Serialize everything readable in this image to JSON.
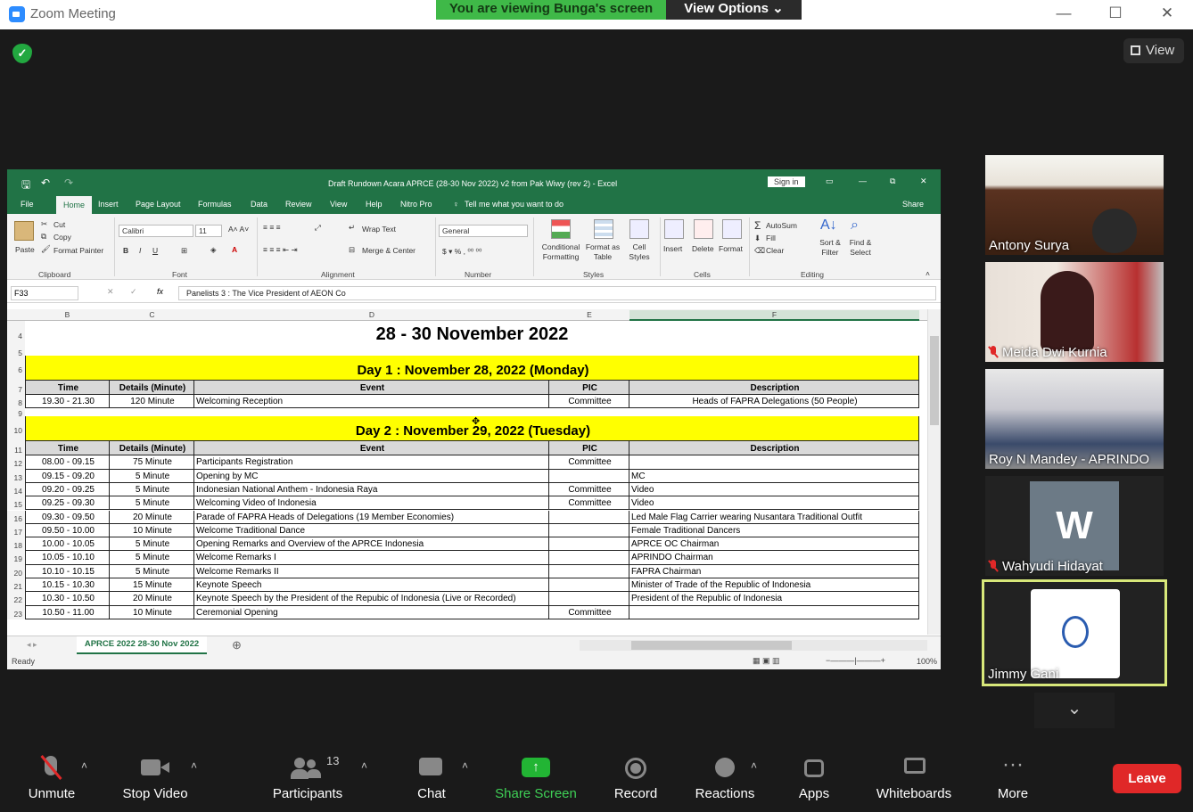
{
  "zoom": {
    "window_title": "Zoom Meeting",
    "share_banner": "You are viewing Bunga's screen",
    "view_options": "View Options ⌄",
    "view_button": "View",
    "leave": "Leave"
  },
  "excel": {
    "title": "Draft Rundown Acara APRCE (28-30 Nov 2022) v2 from Pak Wiwy (rev 2)  -  Excel",
    "sign_in": "Sign in",
    "tabs": [
      "File",
      "Home",
      "Insert",
      "Page Layout",
      "Formulas",
      "Data",
      "Review",
      "View",
      "Help",
      "Nitro Pro"
    ],
    "tell_me": "Tell me what you want to do",
    "share": "Share",
    "ribbon": {
      "paste": "Paste",
      "cut": "Cut",
      "copy": "Copy",
      "format_painter": "Format Painter",
      "clipboard": "Clipboard",
      "font_name": "Calibri",
      "font_size": "11",
      "font": "Font",
      "wrap_text": "Wrap Text",
      "merge_center": "Merge & Center",
      "alignment": "Alignment",
      "number_format": "General",
      "number": "Number",
      "conditional_formatting": "Conditional Formatting",
      "format_as_table": "Format as Table",
      "cell_styles": "Cell Styles",
      "styles": "Styles",
      "insert": "Insert",
      "delete": "Delete",
      "format": "Format",
      "cells": "Cells",
      "autosum": "AutoSum",
      "fill": "Fill",
      "clear": "Clear",
      "sort_filter": "Sort & Filter",
      "find_select": "Find & Select",
      "editing": "Editing"
    },
    "name_box": "F33",
    "formula": "Panelists 3 : The Vice President of AEON Co",
    "columns": [
      "B",
      "C",
      "D",
      "E",
      "F"
    ],
    "sheet_tab": "APRCE 2022 28-30 Nov 2022",
    "status": "Ready",
    "zoom": "100%",
    "rows": [
      {
        "n": "4",
        "type": "title",
        "text": "28 - 30 November 2022"
      },
      {
        "n": "5",
        "type": "blank"
      },
      {
        "n": "6",
        "type": "day",
        "text": "Day 1 : November 28, 2022 (Monday)"
      },
      {
        "n": "7",
        "type": "header",
        "cells": [
          "Time",
          "Details (Minute)",
          "Event",
          "PIC",
          "Description"
        ]
      },
      {
        "n": "8",
        "type": "data",
        "cells": [
          "19.30 - 21.30",
          "120 Minute",
          "Welcoming Reception",
          "Committee",
          "Heads of FAPRA Delegations (50 People)"
        ],
        "desc_center": true
      },
      {
        "n": "9",
        "type": "blank"
      },
      {
        "n": "10",
        "type": "day",
        "text": "Day 2 : November 29, 2022 (Tuesday)"
      },
      {
        "n": "11",
        "type": "header",
        "cells": [
          "Time",
          "Details (Minute)",
          "Event",
          "PIC",
          "Description"
        ]
      },
      {
        "n": "12",
        "type": "data",
        "cells": [
          "08.00 - 09.15",
          "75 Minute",
          "Participants Registration",
          "Committee",
          ""
        ]
      },
      {
        "n": "13",
        "type": "data",
        "cells": [
          "09.15 - 09.20",
          "5 Minute",
          "Opening by MC",
          "",
          "MC"
        ]
      },
      {
        "n": "14",
        "type": "data",
        "cells": [
          "09.20 - 09.25",
          "5 Minute",
          "Indonesian National Anthem - Indonesia Raya",
          "Committee",
          "Video"
        ]
      },
      {
        "n": "15",
        "type": "data",
        "cells": [
          "09.25 - 09.30",
          "5 Minute",
          "Welcoming Video of Indonesia",
          "Committee",
          "Video"
        ]
      },
      {
        "n": "16",
        "type": "data",
        "cells": [
          "09.30 - 09.50",
          "20 Minute",
          "Parade of FAPRA Heads of Delegations (19 Member Economies)",
          "",
          "Led Male Flag Carrier wearing Nusantara Traditional Outfit"
        ]
      },
      {
        "n": "17",
        "type": "data",
        "cells": [
          "09.50 - 10.00",
          "10 Minute",
          "Welcome Traditional Dance",
          "",
          "Female Traditional Dancers"
        ]
      },
      {
        "n": "18",
        "type": "data",
        "cells": [
          "10.00 - 10.05",
          "5 Minute",
          "Opening Remarks and Overview of the APRCE Indonesia",
          "",
          "APRCE OC Chairman"
        ]
      },
      {
        "n": "19",
        "type": "data",
        "cells": [
          "10.05 - 10.10",
          "5 Minute",
          "Welcome Remarks I",
          "",
          "APRINDO Chairman"
        ]
      },
      {
        "n": "20",
        "type": "data",
        "cells": [
          "10.10 - 10.15",
          "5 Minute",
          "Welcome Remarks II",
          "",
          "FAPRA Chairman"
        ]
      },
      {
        "n": "21",
        "type": "data",
        "cells": [
          "10.15 - 10.30",
          "15 Minute",
          "Keynote Speech",
          "",
          "Minister of Trade of the Republic of Indonesia"
        ]
      },
      {
        "n": "22",
        "type": "data",
        "cells": [
          "10.30 - 10.50",
          "20 Minute",
          "Keynote Speech by the President of the Repubic of Indonesia (Live or Recorded)",
          "",
          "President of the Republic of Indonesia"
        ]
      },
      {
        "n": "23",
        "type": "data",
        "cells": [
          "10.50 - 11.00",
          "10 Minute",
          "Ceremonial Opening",
          "Committee",
          ""
        ]
      }
    ]
  },
  "participants": [
    {
      "name": "Antony Surya",
      "muted": false
    },
    {
      "name": "Meida Dwi Kurnia",
      "muted": true
    },
    {
      "name": "Roy N Mandey - APRINDO",
      "muted": false
    },
    {
      "name": "Wahyudi Hidayat",
      "muted": true,
      "initial": "W"
    },
    {
      "name": "Jimmy Gani",
      "muted": false
    }
  ],
  "toolbar": {
    "unmute": "Unmute",
    "stop_video": "Stop Video",
    "participants": "Participants",
    "participants_count": "13",
    "chat": "Chat",
    "share_screen": "Share Screen",
    "record": "Record",
    "reactions": "Reactions",
    "apps": "Apps",
    "whiteboards": "Whiteboards",
    "more": "More"
  }
}
